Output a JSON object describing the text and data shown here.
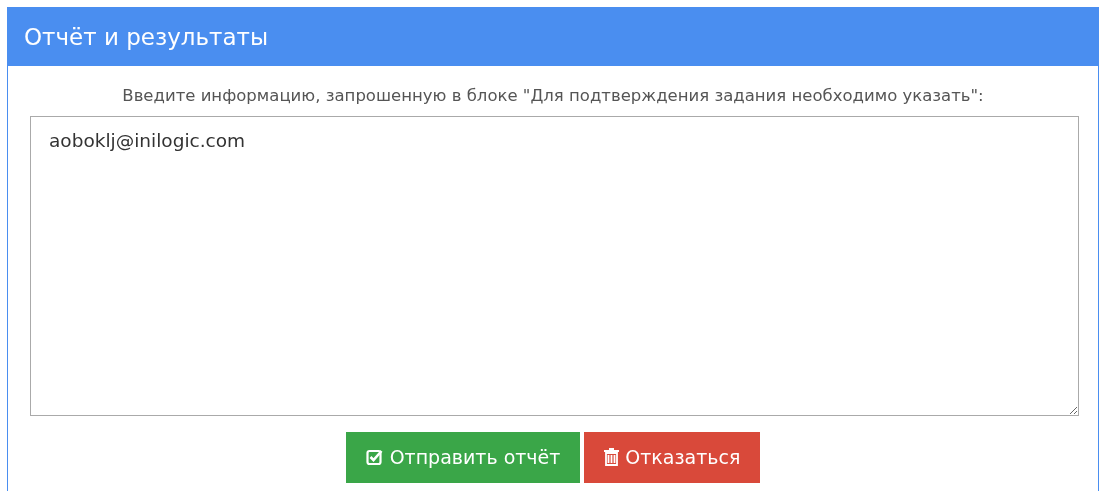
{
  "panel": {
    "title": "Отчёт и результаты"
  },
  "form": {
    "label": "Введите информацию, запрошенную в блоке \"Для подтверждения задания необходимо указать\":",
    "value": "aoboklj@inilogic.com"
  },
  "buttons": [
    {
      "kind": "submit",
      "label": "Отправить отчёт"
    },
    {
      "kind": "refuse",
      "label": "Отказаться"
    }
  ]
}
